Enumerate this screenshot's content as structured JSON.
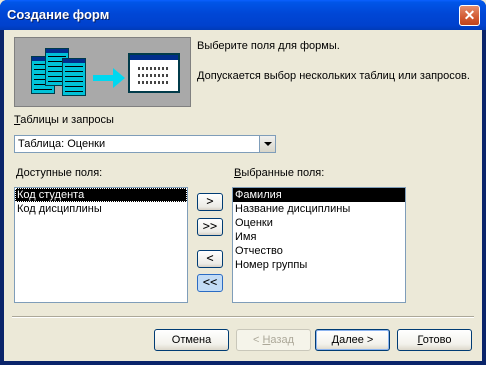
{
  "window": {
    "title": "Создание форм",
    "close_symbol": "✕"
  },
  "header": {
    "info_line1": "Выберите поля для формы.",
    "info_line2": "Допускается выбор нескольких таблиц или запросов."
  },
  "source": {
    "label_accel": "Т",
    "label_rest": "аблицы и запросы",
    "selected_value": "Таблица: Оценки"
  },
  "available": {
    "label_accel": "Д",
    "label_rest": "оступные поля:",
    "items": [
      "Код студента",
      "Код дисциплины"
    ],
    "selected_index": 0
  },
  "selected": {
    "label_accel": "В",
    "label_rest": "ыбранные поля:",
    "items": [
      "Фамилия",
      "Название дисциплины",
      "Оценки",
      "Имя",
      "Отчество",
      "Номер группы"
    ],
    "selected_index": 0
  },
  "move_buttons": {
    "add_one": ">",
    "add_all": ">>",
    "remove_one": "<",
    "remove_all": "<<"
  },
  "footer": {
    "cancel": "Отмена",
    "back_prefix": "< ",
    "back_accel": "Н",
    "back_rest": "азад",
    "next_accel": "Д",
    "next_rest": "алее >",
    "finish_accel": "Г",
    "finish_rest": "отово"
  },
  "icons": {
    "close": "close-icon",
    "dropdown": "chevron-down-icon",
    "wizard": "form-wizard-illustration"
  },
  "colors": {
    "titlebar": "#0047d6",
    "dialog_bg": "#ece9d8",
    "selection": "#000000",
    "illustration_bg": "#a9a9a9",
    "illustration_accent": "#00c2d8"
  }
}
